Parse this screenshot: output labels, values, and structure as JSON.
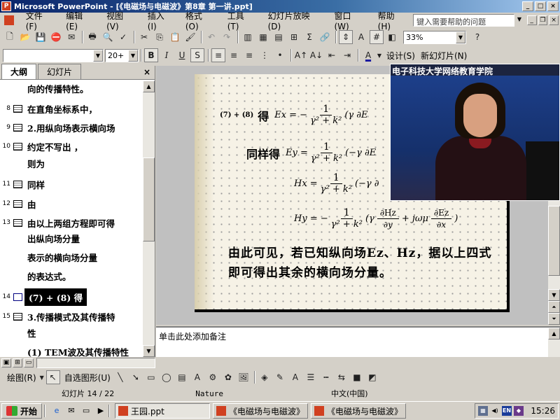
{
  "window": {
    "title": "Microsoft PowerPoint - [《电磁场与电磁波》第8章 第一讲.ppt]"
  },
  "menu": {
    "items": [
      "文件(F)",
      "编辑(E)",
      "视图(V)",
      "插入(I)",
      "格式(O)",
      "工具(T)",
      "幻灯片放映(D)",
      "窗口(W)",
      "帮助(H)"
    ],
    "help_placeholder": "键入需要帮助的问题"
  },
  "toolbar": {
    "zoom": "33%",
    "font_size": "20+",
    "design_label": "设计(S)",
    "new_slide_label": "新幻灯片(N)"
  },
  "outline": {
    "tabs": [
      "大纲",
      "幻灯片"
    ],
    "rows": [
      {
        "num": "",
        "text": "向的传播特性。"
      },
      {
        "num": "8",
        "text": "在直角坐标系中，"
      },
      {
        "num": "9",
        "text": "2.用纵向场表示横向场"
      },
      {
        "num": "10",
        "text": "约定不写出        ，"
      },
      {
        "num": "",
        "text": "则为"
      },
      {
        "num": "11",
        "text": "同样"
      },
      {
        "num": "12",
        "text": "由"
      },
      {
        "num": "13",
        "text": "由以上两组方程即可得"
      },
      {
        "num": "",
        "text": "出纵向场分量"
      },
      {
        "num": "",
        "text": "表示的横向场分量"
      },
      {
        "num": "",
        "text": "的表达式。"
      },
      {
        "num": "14",
        "text": "(7) + (8) 得",
        "selected": true
      },
      {
        "num": "15",
        "text": "3.传播模式及其传播特"
      },
      {
        "num": "",
        "text": "性"
      },
      {
        "num": "",
        "text": "(1) TEM波及其传播特性"
      }
    ]
  },
  "slide": {
    "eq_tag": "(7) + (8)",
    "eq1_word": "得",
    "eq2_word": "同样得",
    "eq1_lhs": "Ex = −",
    "eq2_lhs": "Ey =",
    "eq3_lhs": "Hx =",
    "eq4_lhs": "Hy = −",
    "frac_num": "1",
    "frac_den": "γ² + k²",
    "eq1_rhs": "(γ ∂E",
    "eq2_rhs": "(−γ ∂E",
    "eq3_rhs": "(−γ ∂",
    "eq4_rhs_a": "(γ",
    "eq4_frac1_num": "∂Hz",
    "eq4_frac1_den": "∂y",
    "eq4_mid": "+ jωμ",
    "eq4_frac2_num": "∂Ez",
    "eq4_frac2_den": "∂x",
    "eq4_end": ")",
    "caption": "由此可见，若已知纵向场Ez、Hz，据以上四式即可得出其余的横向场分量。"
  },
  "video": {
    "caption": "电子科技大学网络教育学院"
  },
  "notes": {
    "placeholder": "单击此处添加备注"
  },
  "drawing_toolbar": {
    "draw_label": "绘图(R)",
    "autoshape_label": "自选图形(U)"
  },
  "status": {
    "slide_no": "幻灯片 14 / 22",
    "design": "Nature",
    "language": "中文(中国)"
  },
  "taskbar": {
    "start": "开始",
    "tasks": [
      "王园.ppt",
      "《电磁场与电磁波》",
      "《电磁场与电磁波》"
    ],
    "tray_lang": "EN",
    "clock": "15:26"
  }
}
